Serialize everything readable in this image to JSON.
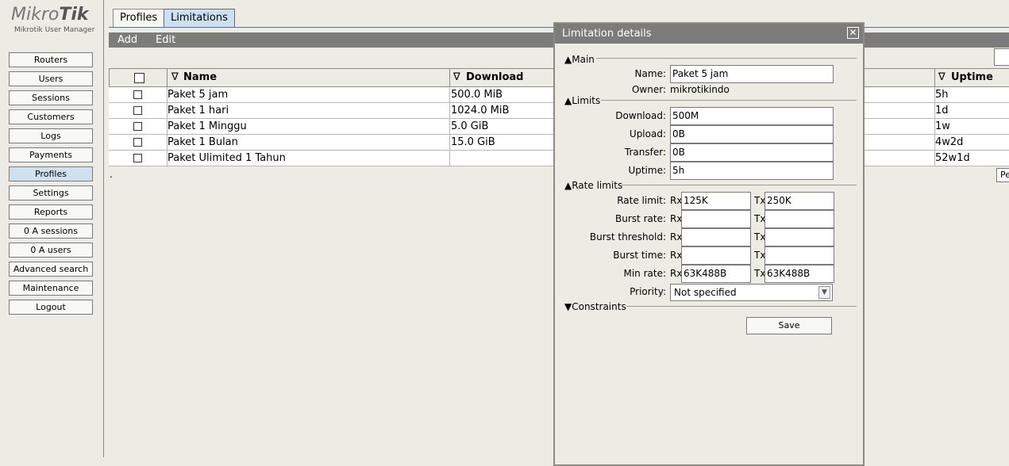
{
  "brand": {
    "logo_prefix": "Mikro",
    "logo_bold": "Tik",
    "subtitle": "Mikrotik User Manager"
  },
  "sidebar": {
    "items": [
      {
        "label": "Routers"
      },
      {
        "label": "Users"
      },
      {
        "label": "Sessions"
      },
      {
        "label": "Customers"
      },
      {
        "label": "Logs"
      },
      {
        "label": "Payments"
      },
      {
        "label": "Profiles"
      },
      {
        "label": "Settings"
      },
      {
        "label": "Reports"
      },
      {
        "label": "0 A sessions"
      },
      {
        "label": "0 A users"
      },
      {
        "label": "Advanced search"
      },
      {
        "label": "Maintenance"
      },
      {
        "label": "Logout"
      }
    ],
    "active": "Profiles"
  },
  "tabs": [
    {
      "label": "Profiles"
    },
    {
      "label": "Limitations"
    }
  ],
  "toolbar": {
    "add_label": "Add",
    "edit_label": "Edit"
  },
  "table": {
    "columns": {
      "name": "Name",
      "download": "Download",
      "uptime": "Uptime",
      "sort_glyph": "∇"
    },
    "rows": [
      {
        "name": "Paket 5 jam",
        "download": "500.0 MiB",
        "uptime": "5h"
      },
      {
        "name": "Paket 1 hari",
        "download": "1024.0 MiB",
        "uptime": "1d"
      },
      {
        "name": "Paket 1 Minggu",
        "download": "5.0 GiB",
        "uptime": "1w"
      },
      {
        "name": "Paket 1 Bulan",
        "download": "15.0 GiB",
        "uptime": "4w2d"
      },
      {
        "name": "Paket Ulimited 1 Tahun",
        "download": "",
        "uptime": "52w1d"
      }
    ],
    "footer_dot": ".",
    "pe_label": "Pe"
  },
  "dialog": {
    "title": "Limitation details",
    "close_glyph": "✕",
    "sections": {
      "main": "Main",
      "limits": "Limits",
      "rate_limits": "Rate limits",
      "constraints": "Constraints"
    },
    "main": {
      "name_label": "Name:",
      "name_value": "Paket 5 jam",
      "owner_label": "Owner:",
      "owner_value": "mikrotikindo"
    },
    "limits": {
      "download_label": "Download:",
      "download_value": "500M",
      "upload_label": "Upload:",
      "upload_value": "0B",
      "transfer_label": "Transfer:",
      "transfer_value": "0B",
      "uptime_label": "Uptime:",
      "uptime_value": "5h"
    },
    "rate": {
      "rx": "Rx",
      "tx": "Tx",
      "rate_limit_label": "Rate limit:",
      "rate_limit_rx": "125K",
      "rate_limit_tx": "250K",
      "burst_rate_label": "Burst rate:",
      "burst_rate_rx": "",
      "burst_rate_tx": "",
      "burst_threshold_label": "Burst threshold:",
      "burst_threshold_rx": "",
      "burst_threshold_tx": "",
      "burst_time_label": "Burst time:",
      "burst_time_rx": "",
      "burst_time_tx": "",
      "min_rate_label": "Min rate:",
      "min_rate_rx": "63K488B",
      "min_rate_tx": "63K488B",
      "priority_label": "Priority:",
      "priority_value": "Not specified"
    },
    "save_label": "Save"
  }
}
